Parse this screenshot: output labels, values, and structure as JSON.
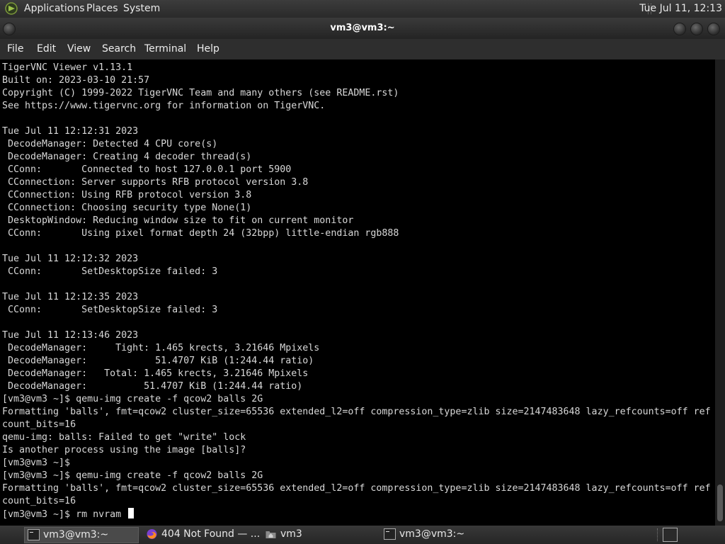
{
  "top_panel": {
    "menus": [
      "Applications",
      "Places",
      "System"
    ],
    "clock": "Tue Jul 11, 12:13"
  },
  "window": {
    "title": "vm3@vm3:~"
  },
  "menubar": [
    "File",
    "Edit",
    "View",
    "Search",
    "Terminal",
    "Help"
  ],
  "terminal": {
    "lines": [
      "TigerVNC Viewer v1.13.1",
      "Built on: 2023-03-10 21:57",
      "Copyright (C) 1999-2022 TigerVNC Team and many others (see README.rst)",
      "See https://www.tigervnc.org for information on TigerVNC.",
      "",
      "Tue Jul 11 12:12:31 2023",
      " DecodeManager: Detected 4 CPU core(s)",
      " DecodeManager: Creating 4 decoder thread(s)",
      " CConn:       Connected to host 127.0.0.1 port 5900",
      " CConnection: Server supports RFB protocol version 3.8",
      " CConnection: Using RFB protocol version 3.8",
      " CConnection: Choosing security type None(1)",
      " DesktopWindow: Reducing window size to fit on current monitor",
      " CConn:       Using pixel format depth 24 (32bpp) little-endian rgb888",
      "",
      "Tue Jul 11 12:12:32 2023",
      " CConn:       SetDesktopSize failed: 3",
      "",
      "Tue Jul 11 12:12:35 2023",
      " CConn:       SetDesktopSize failed: 3",
      "",
      "Tue Jul 11 12:13:46 2023",
      " DecodeManager:     Tight: 1.465 krects, 3.21646 Mpixels",
      " DecodeManager:            51.4707 KiB (1:244.44 ratio)",
      " DecodeManager:   Total: 1.465 krects, 3.21646 Mpixels",
      " DecodeManager:          51.4707 KiB (1:244.44 ratio)",
      "[vm3@vm3 ~]$ qemu-img create -f qcow2 balls 2G",
      "Formatting 'balls', fmt=qcow2 cluster_size=65536 extended_l2=off compression_type=zlib size=2147483648 lazy_refcounts=off ref",
      "count_bits=16",
      "qemu-img: balls: Failed to get \"write\" lock",
      "Is another process using the image [balls]?",
      "[vm3@vm3 ~]$",
      "[vm3@vm3 ~]$ qemu-img create -f qcow2 balls 2G",
      "Formatting 'balls', fmt=qcow2 cluster_size=65536 extended_l2=off compression_type=zlib size=2147483648 lazy_refcounts=off ref",
      "count_bits=16"
    ],
    "prompt": "[vm3@vm3 ~]$ rm nvram "
  },
  "taskbar": {
    "tasks": [
      {
        "label": "vm3@vm3:~",
        "icon": "terminal-icon"
      },
      {
        "label": "404 Not Found — ...",
        "icon": "firefox-icon"
      },
      {
        "label": "vm3",
        "icon": "home-folder-icon"
      },
      {
        "label": "vm3@vm3:~",
        "icon": "terminal-icon"
      }
    ]
  }
}
